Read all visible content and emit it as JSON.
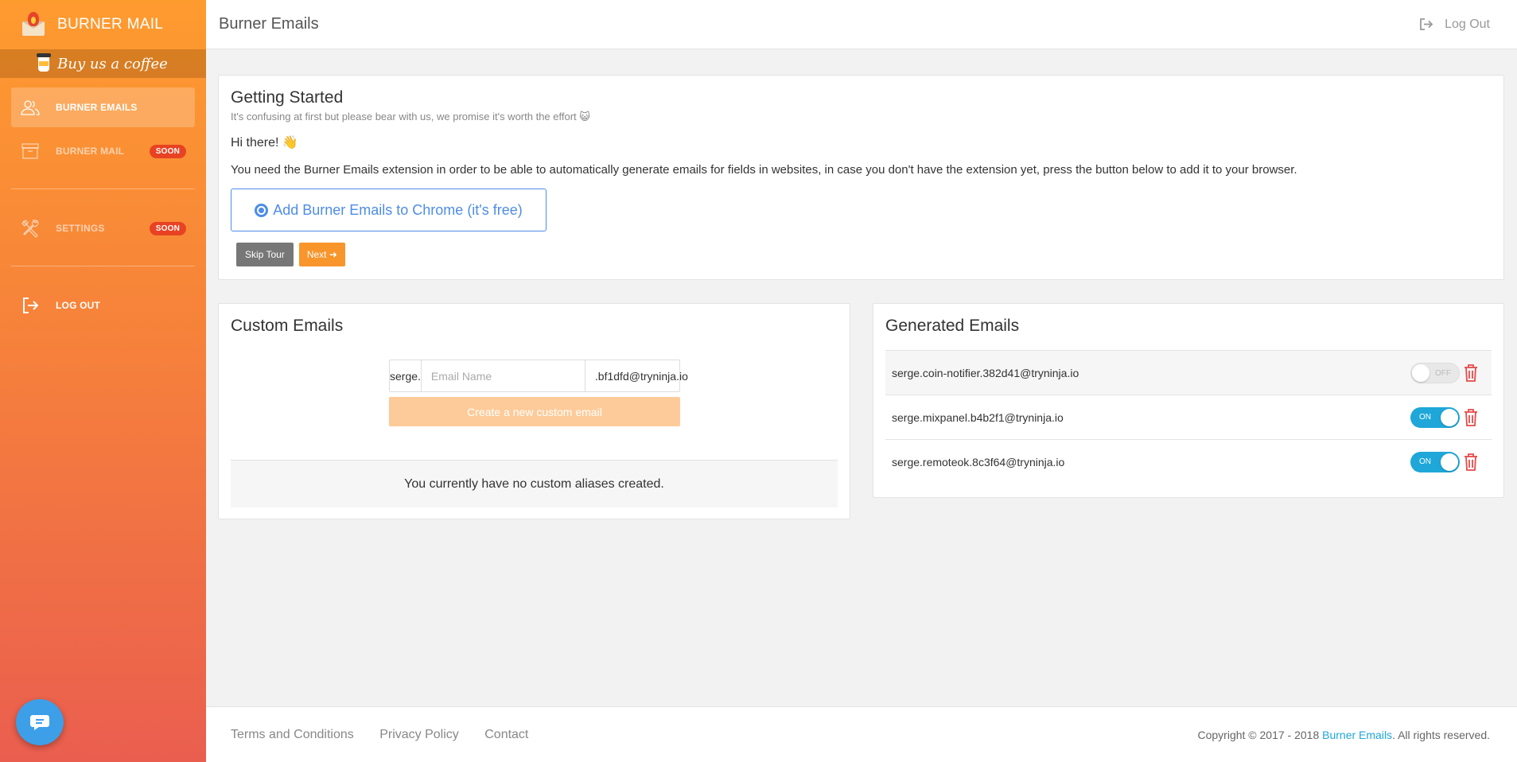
{
  "sidebar": {
    "brand": "BURNER MAIL",
    "coffee": "Buy us a coffee",
    "items": [
      {
        "label": "BURNER EMAILS",
        "badge": ""
      },
      {
        "label": "BURNER MAIL",
        "badge": "SOON"
      },
      {
        "label": "SETTINGS",
        "badge": "SOON"
      },
      {
        "label": "LOG OUT",
        "badge": ""
      }
    ]
  },
  "header": {
    "title": "Burner Emails",
    "logout": "Log Out"
  },
  "getting_started": {
    "title": "Getting Started",
    "subtitle": "It's confusing at first but please bear with us, we promise it's worth the effort 😺",
    "greeting": "Hi there! 👋",
    "description": "You need the Burner Emails extension in order to be able to automatically generate emails for fields in websites, in case you don't have the extension yet, press the button below to add it to your browser.",
    "chrome_button": "Add Burner Emails to Chrome (it's free)",
    "skip_label": "Skip Tour",
    "next_label": "Next"
  },
  "custom_emails": {
    "title": "Custom Emails",
    "prefix": "serge.",
    "placeholder": "Email Name",
    "suffix": ".bf1dfd@tryninja.io",
    "create_label": "Create a new custom email",
    "empty_text": "You currently have no custom aliases created."
  },
  "generated_emails": {
    "title": "Generated Emails",
    "rows": [
      {
        "email": "serge.coin-notifier.382d41@tryninja.io",
        "state": "OFF"
      },
      {
        "email": "serge.mixpanel.b4b2f1@tryninja.io",
        "state": "ON"
      },
      {
        "email": "serge.remoteok.8c3f64@tryninja.io",
        "state": "ON"
      }
    ]
  },
  "footer": {
    "links": [
      "Terms and Conditions",
      "Privacy Policy",
      "Contact"
    ],
    "copyright_prefix": "Copyright © 2017 - 2018 ",
    "copyright_brand": "Burner Emails",
    "copyright_suffix": ". All rights reserved."
  },
  "colors": {
    "accent": "#f8952b",
    "toggle_on": "#1ea7d8",
    "danger": "#e84a4a",
    "chrome_blue": "#4e8ce8"
  }
}
